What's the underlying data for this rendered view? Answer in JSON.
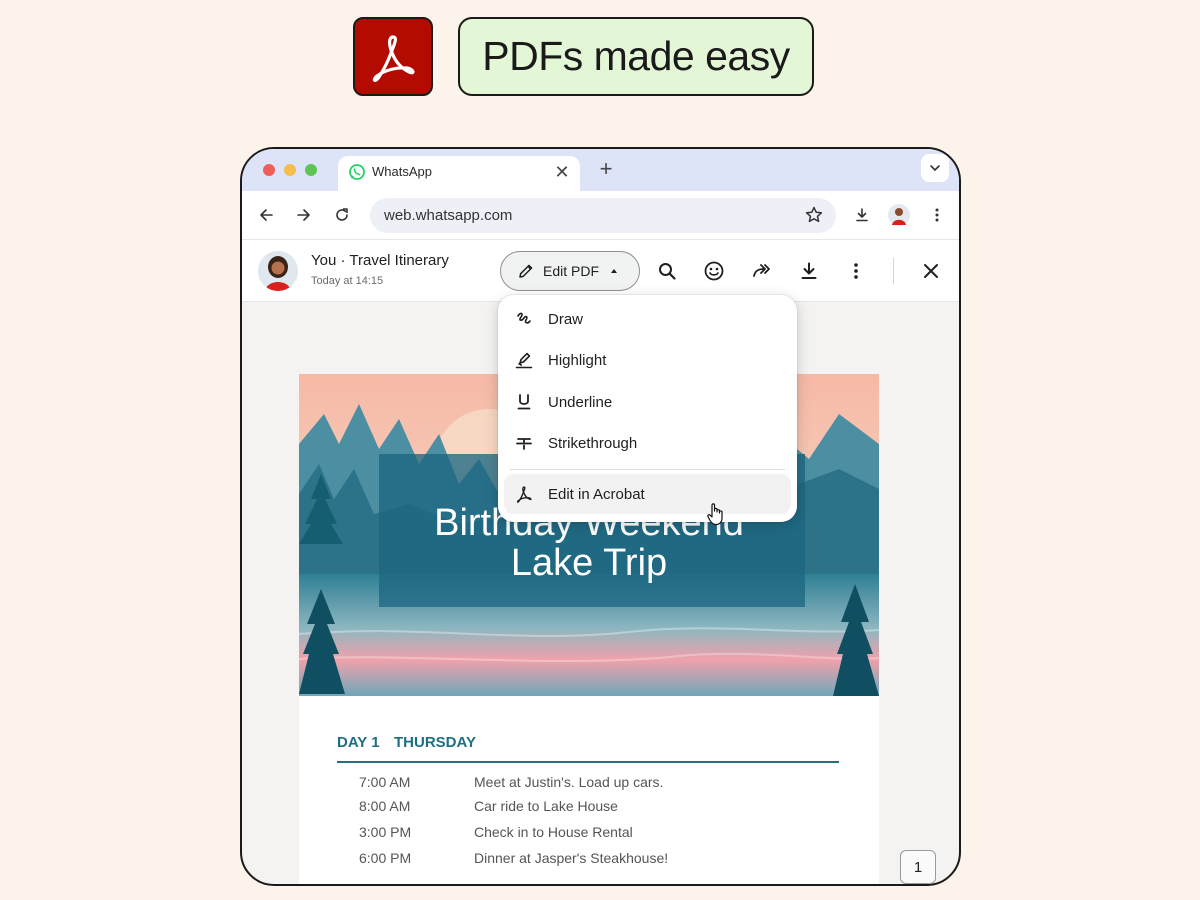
{
  "hero": {
    "tagline": "PDFs made easy",
    "brand_color": "#b30b00",
    "logo_icon": "acrobat-logo-icon"
  },
  "browser": {
    "tab": {
      "title": "WhatsApp",
      "favicon": "whatsapp-icon"
    },
    "new_tab_icon": "+",
    "close_tab_icon": "✕",
    "address": "web.whatsapp.com"
  },
  "viewer": {
    "sender": "You · Travel Itinerary",
    "timestamp": "Today at 14:15",
    "edit_button_label": "Edit PDF",
    "actions": [
      "search-icon",
      "emoji-icon",
      "forward-icon",
      "download-icon",
      "more-icon",
      "close-icon"
    ]
  },
  "menu": {
    "items": [
      {
        "label": "Draw",
        "icon": "draw-icon"
      },
      {
        "label": "Highlight",
        "icon": "highlight-icon"
      },
      {
        "label": "Underline",
        "icon": "underline-icon"
      },
      {
        "label": "Strikethrough",
        "icon": "strikethrough-icon"
      }
    ],
    "acrobat_item": {
      "label": "Edit in Acrobat",
      "icon": "acrobat-icon"
    }
  },
  "document": {
    "title_line1": "Birthday Weekend",
    "title_line2": "Lake Trip",
    "day_label": "DAY 1",
    "day_name": "THURSDAY",
    "schedule": [
      {
        "time": "7:00 AM",
        "desc": "Meet at Justin's. Load up cars."
      },
      {
        "time": "8:00 AM",
        "desc": "Car ride to Lake House"
      },
      {
        "time": "3:00 PM",
        "desc": "Check in to House Rental"
      },
      {
        "time": "6:00 PM",
        "desc": "Dinner at Jasper's Steakhouse!"
      }
    ],
    "page_number": "1"
  }
}
